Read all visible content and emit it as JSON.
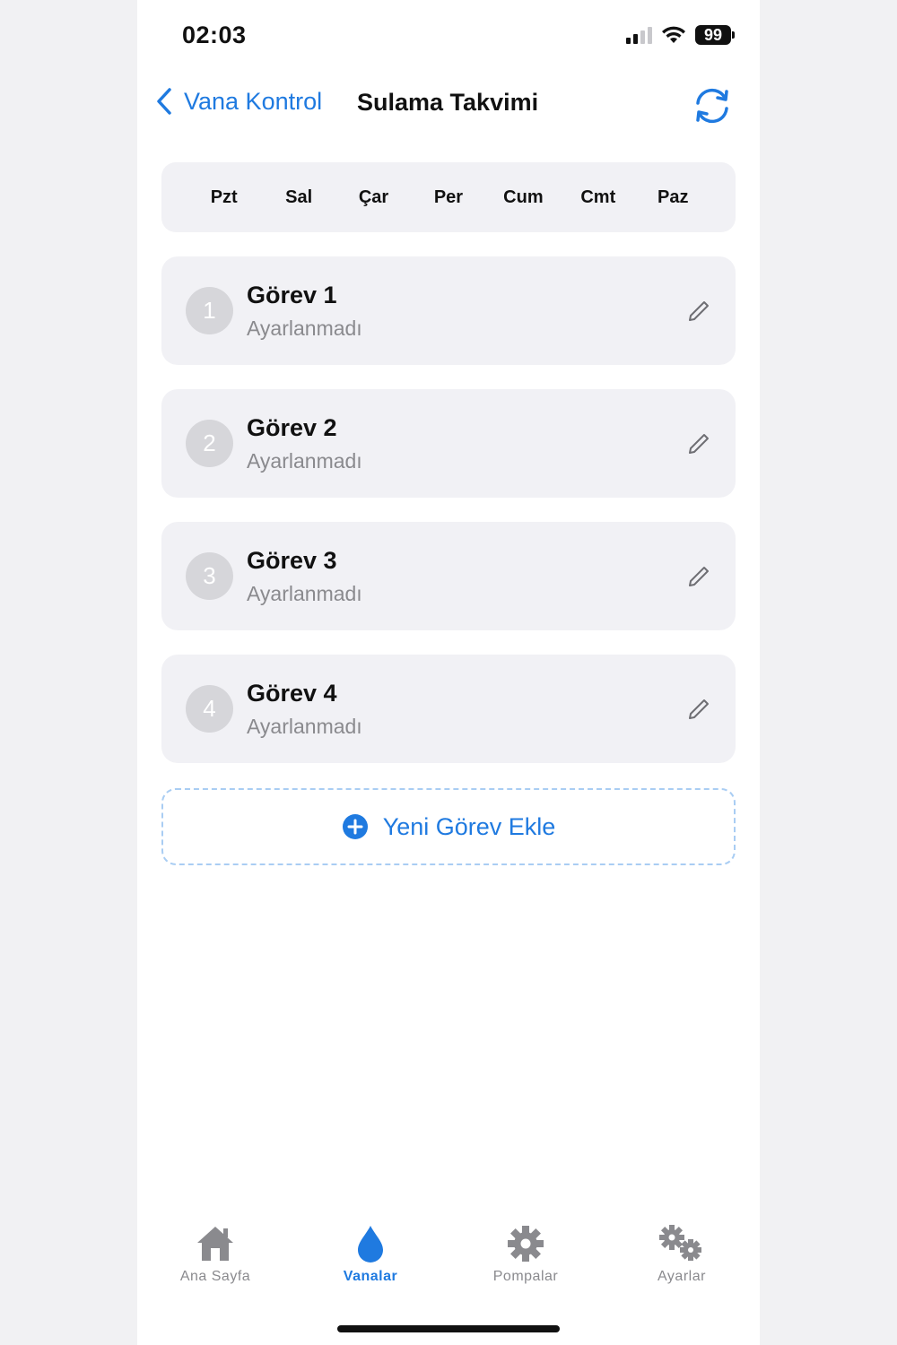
{
  "status_bar": {
    "time": "02:03",
    "battery": "99"
  },
  "nav": {
    "back_label": "Vana Kontrol",
    "title": "Sulama Takvimi"
  },
  "days": [
    "Pzt",
    "Sal",
    "Çar",
    "Per",
    "Cum",
    "Cmt",
    "Paz"
  ],
  "tasks": [
    {
      "number": "1",
      "title": "Görev 1",
      "subtitle": "Ayarlanmadı"
    },
    {
      "number": "2",
      "title": "Görev 2",
      "subtitle": "Ayarlanmadı"
    },
    {
      "number": "3",
      "title": "Görev 3",
      "subtitle": "Ayarlanmadı"
    },
    {
      "number": "4",
      "title": "Görev 4",
      "subtitle": "Ayarlanmadı"
    }
  ],
  "add_task": {
    "label": "Yeni Görev Ekle",
    "icon": "plus-circle-icon"
  },
  "tabbar": {
    "items": [
      {
        "label": "Ana Sayfa",
        "icon": "house-icon",
        "active": false
      },
      {
        "label": "Vanalar",
        "icon": "water-drop-icon",
        "active": true
      },
      {
        "label": "Pompalar",
        "icon": "gear-icon",
        "active": false
      },
      {
        "label": "Ayarlar",
        "icon": "gears-icon",
        "active": false
      }
    ]
  },
  "colors": {
    "accent": "#1f7ae0",
    "card_bg": "#f1f1f5",
    "muted": "#8a8a8e"
  }
}
